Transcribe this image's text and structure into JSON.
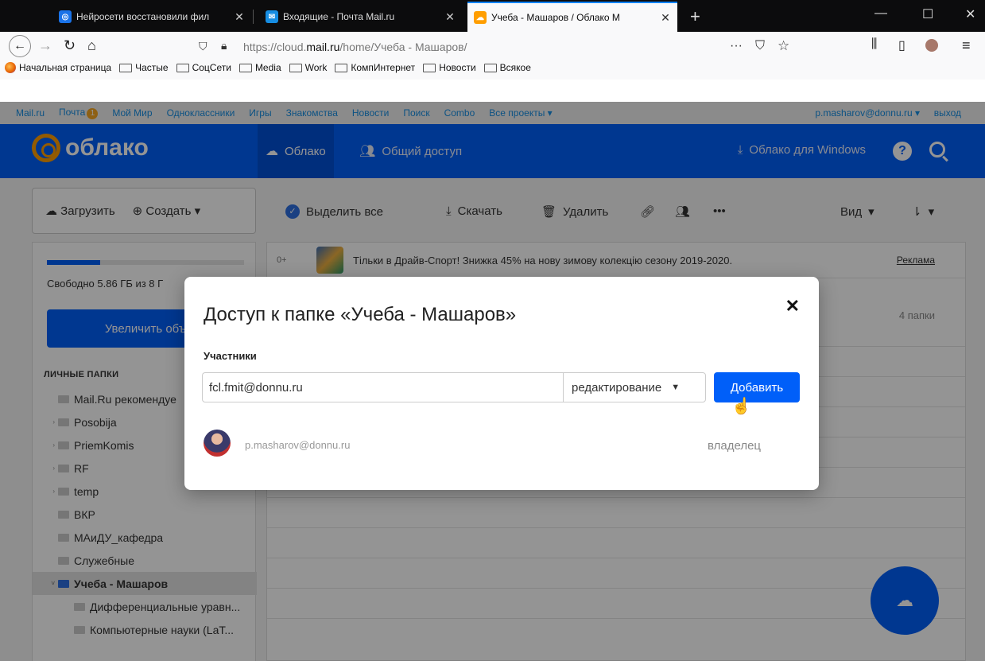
{
  "browser": {
    "tabs": [
      {
        "title": "Нейросети восстановили фил",
        "fav_color": "#1a73e8"
      },
      {
        "title": "Входящие - Почта Mail.ru",
        "fav_color": "#168de2"
      },
      {
        "title": "Учеба - Машаров / Облако М",
        "fav_color": "#ff9e00",
        "active": true
      }
    ],
    "url_prefix": "https://cloud.",
    "url_domain": "mail.ru",
    "url_path": "/home/Учеба - Машаров/",
    "bookmarks": [
      "Начальная страница",
      "Частые",
      "СоцСети",
      "Media",
      "Work",
      "КомпИнтернет",
      "Новости",
      "Всякое"
    ]
  },
  "portal": {
    "links": [
      "Mail.ru",
      "Почта",
      "Мой Мир",
      "Одноклассники",
      "Игры",
      "Знакомства",
      "Новости",
      "Поиск",
      "Combo",
      "Все проекты"
    ],
    "mail_count": "1",
    "user": "p.masharov@donnu.ru",
    "logout": "выход"
  },
  "header": {
    "logo": "облако",
    "tab_cloud": "Облако",
    "tab_shared": "Общий доступ",
    "windows": "Облако для Windows"
  },
  "sidebar": {
    "upload": "Загрузить",
    "create": "Создать",
    "quota_text": "Свободно 5.86 ГБ из 8 Г",
    "quota_used": 0.27,
    "increase": "Увеличить объ",
    "folders_label": "ЛИЧНЫЕ ПАПКИ",
    "folders": [
      {
        "name": "Mail.Ru рекомендуе",
        "arrow": ""
      },
      {
        "name": "Posobija",
        "arrow": "›"
      },
      {
        "name": "PriemKomis",
        "arrow": "›"
      },
      {
        "name": "RF",
        "arrow": "›"
      },
      {
        "name": "temp",
        "arrow": "›"
      },
      {
        "name": "ВКР",
        "arrow": ""
      },
      {
        "name": "МАиДУ_кафедра",
        "arrow": ""
      },
      {
        "name": "Служебные",
        "arrow": ""
      },
      {
        "name": "Учеба - Машаров",
        "arrow": "˅",
        "selected": true
      },
      {
        "name": "Дифференциальные уравн...",
        "arrow": "",
        "indent": true
      },
      {
        "name": "Компьютерные науки (LaT...",
        "arrow": "",
        "indent": true
      }
    ]
  },
  "toolbar": {
    "select_all": "Выделить все",
    "download": "Скачать",
    "delete": "Удалить",
    "view": "Вид"
  },
  "list": {
    "ad_age": "0+",
    "ad_text": "Тільки в Драйв-Спорт!   Знижка 45% на нову зимову колекцію сезону 2019-2020.",
    "ad_label": "Реклама",
    "count": "4 папки"
  },
  "modal": {
    "title": "Доступ к папке «Учеба - Машаров»",
    "participants_label": "Участники",
    "email_value": "fcl.fmit@donnu.ru",
    "permission": "редактирование",
    "add_button": "Добавить",
    "owner_email": "p.masharov@donnu.ru",
    "owner_role": "владелец"
  }
}
